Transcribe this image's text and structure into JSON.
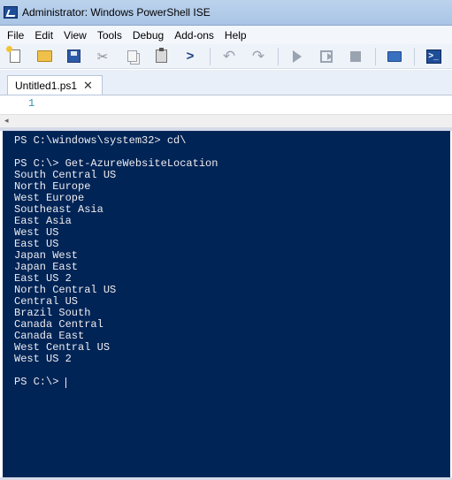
{
  "window": {
    "title": "Administrator: Windows PowerShell ISE"
  },
  "menu": [
    "File",
    "Edit",
    "View",
    "Tools",
    "Debug",
    "Add-ons",
    "Help"
  ],
  "toolbar": {
    "icons": [
      "new-file-icon",
      "open-folder-icon",
      "save-icon",
      "cut-icon",
      "copy-icon",
      "paste-icon",
      "console-icon",
      "undo-icon",
      "redo-icon",
      "run-script-icon",
      "run-selection-icon",
      "stop-icon",
      "remote-powershell-icon",
      "powershell-icon"
    ]
  },
  "tab": {
    "label": "Untitled1.ps1",
    "close": "✕"
  },
  "editor": {
    "line_number": "1"
  },
  "console": {
    "prompt1": "PS C:\\windows\\system32> cd\\",
    "prompt2": "PS C:\\> Get-AzureWebsiteLocation",
    "locations": [
      "South Central US",
      "North Europe",
      "West Europe",
      "Southeast Asia",
      "East Asia",
      "West US",
      "East US",
      "Japan West",
      "Japan East",
      "East US 2",
      "North Central US",
      "Central US",
      "Brazil South",
      "Canada Central",
      "Canada East",
      "West Central US",
      "West US 2"
    ],
    "prompt3": "PS C:\\> "
  },
  "colors": {
    "console_bg": "#012456",
    "console_fg": "#eeedf0",
    "line_number": "#2b91af"
  }
}
